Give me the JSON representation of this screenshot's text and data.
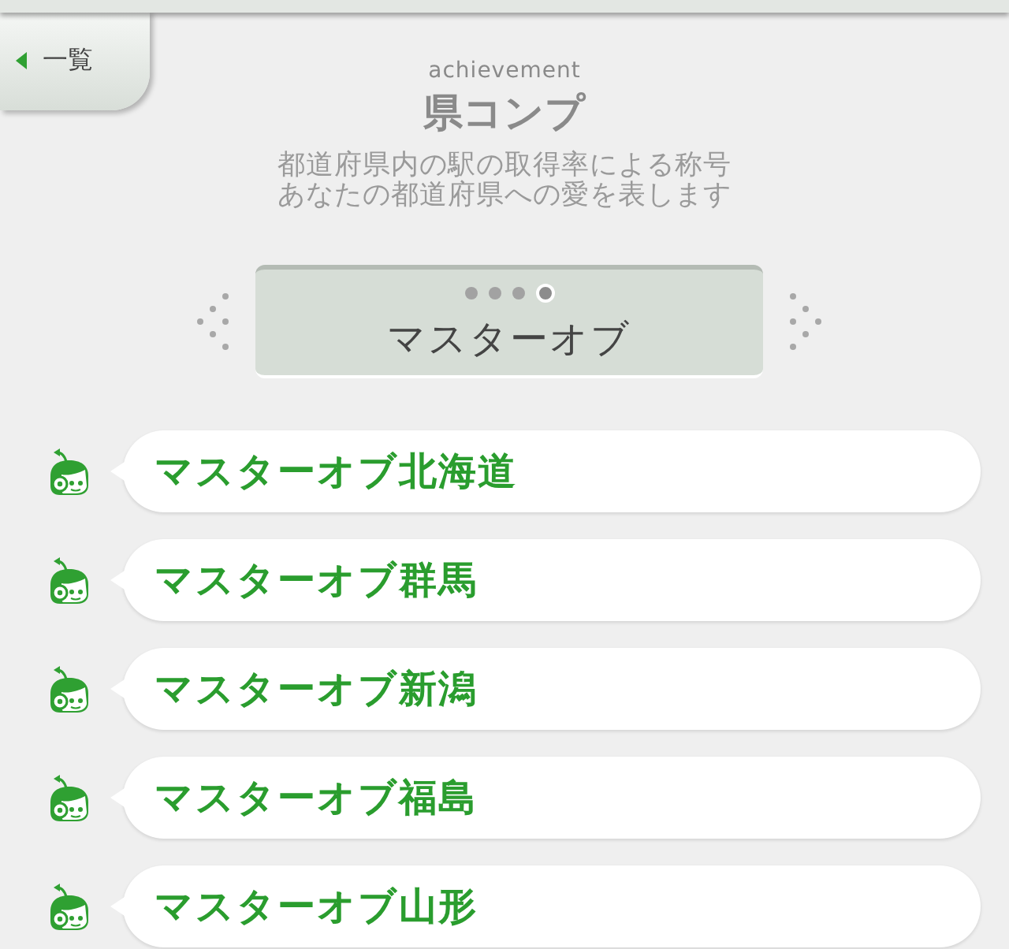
{
  "back_button": {
    "label": "一覧"
  },
  "header": {
    "subtitle": "achievement",
    "title": "県コンプ",
    "description": [
      "都道府県内の駅の取得率による称号",
      "あなたの都道府県への愛を表します"
    ]
  },
  "category": {
    "pages": [
      {
        "selected": false
      },
      {
        "selected": false
      },
      {
        "selected": false
      },
      {
        "selected": true
      }
    ],
    "label": "マスターオブ"
  },
  "titles": [
    {
      "label": "マスターオブ北海道"
    },
    {
      "label": "マスターオブ群馬"
    },
    {
      "label": "マスターオブ新潟"
    },
    {
      "label": "マスターオブ福島"
    },
    {
      "label": "マスターオブ山形"
    }
  ]
}
